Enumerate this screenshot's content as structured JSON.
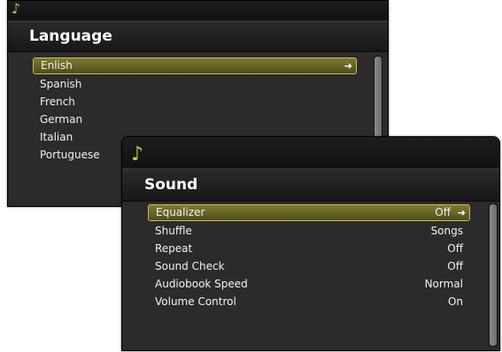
{
  "language_window": {
    "title": "Language",
    "items": [
      {
        "label": "Enlish",
        "selected": true
      },
      {
        "label": "Spanish"
      },
      {
        "label": "French"
      },
      {
        "label": "German"
      },
      {
        "label": "Italian"
      },
      {
        "label": "Portuguese"
      }
    ],
    "selected_arrow": "➜"
  },
  "sound_window": {
    "title": "Sound",
    "items": [
      {
        "label": "Equalizer",
        "value": "Off",
        "selected": true
      },
      {
        "label": "Shuffle",
        "value": "Songs"
      },
      {
        "label": "Repeat",
        "value": "Off"
      },
      {
        "label": "Sound Check",
        "value": "Off"
      },
      {
        "label": "Audiobook Speed",
        "value": "Normal"
      },
      {
        "label": "Volume Control",
        "value": "On"
      }
    ],
    "selected_arrow": "➜"
  },
  "icons": {
    "app_icon": "music-note-icon",
    "selected_arrow_icon": "arrow-right-icon"
  },
  "colors": {
    "accent": "#c4c05a",
    "selected_fill": "#6b6828",
    "window_bg": "#2b2b2b",
    "text": "#f2f2f2"
  }
}
